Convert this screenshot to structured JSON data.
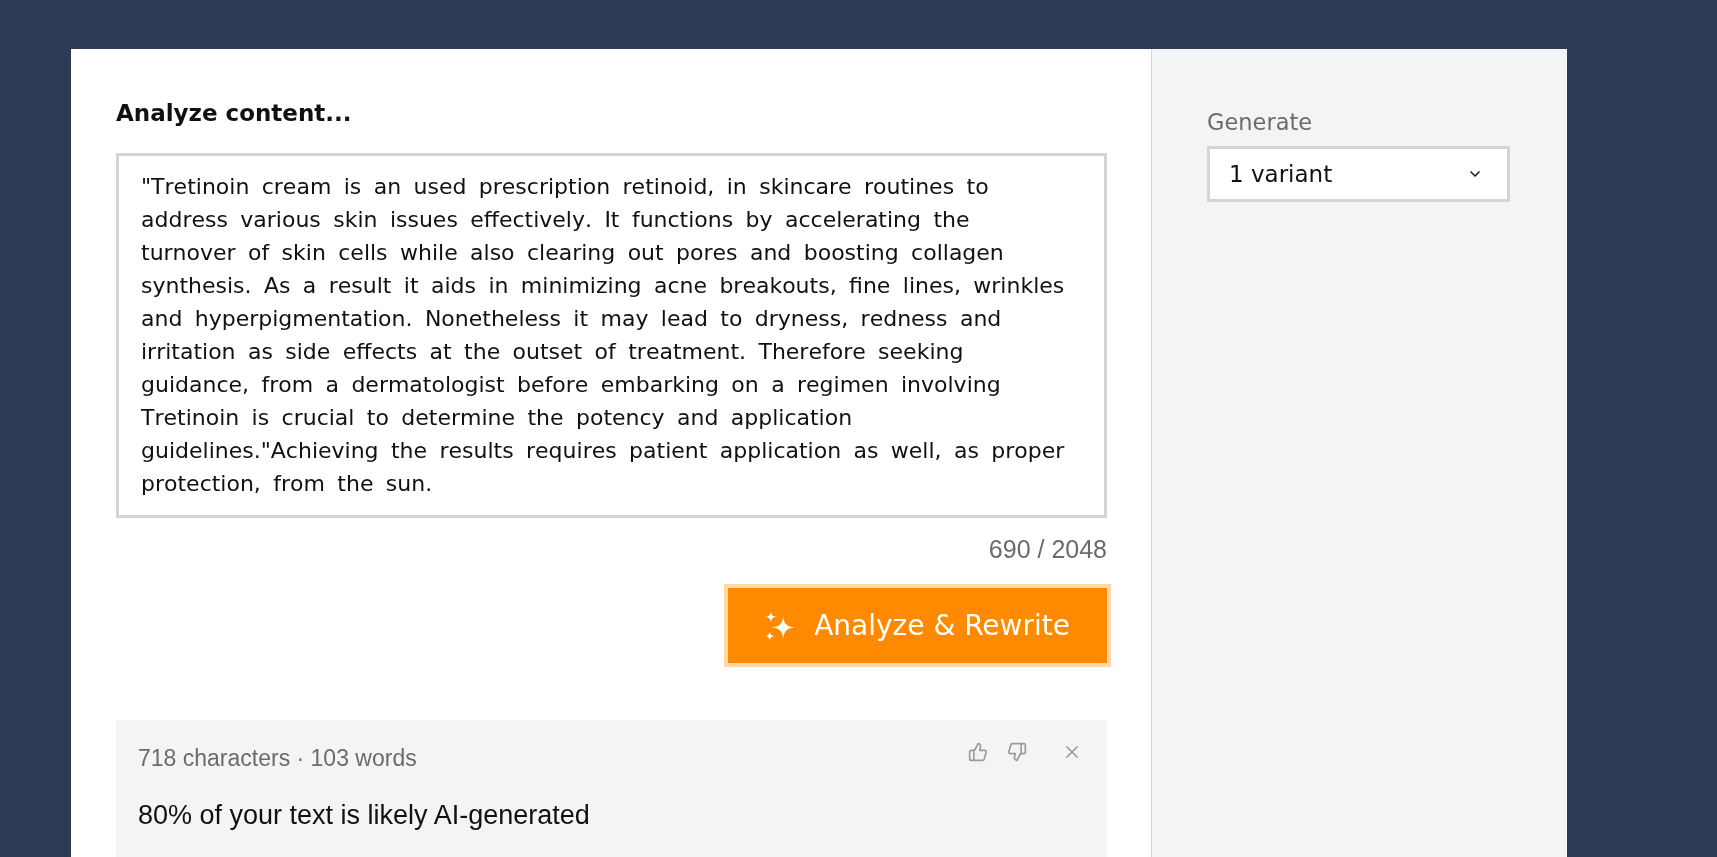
{
  "editor": {
    "heading": "Analyze content...",
    "text": "\"Tretinoin cream is an used prescription retinoid, in skincare routines to address various skin issues effectively. It functions by accelerating the turnover of skin cells while also clearing out pores and boosting collagen synthesis. As a result it aids in minimizing acne breakouts, fine lines, wrinkles and hyperpigmentation. Nonetheless it may lead to dryness, redness and irritation as side effects at the outset of treatment. Therefore seeking guidance, from a dermatologist before embarking on a regimen involving Tretinoin is crucial to determine the potency and application guidelines.\"Achieving the results requires patient application as well, as proper protection, from the sun.",
    "counter": "690 / 2048"
  },
  "analyze_button": {
    "label": "Analyze & Rewrite",
    "focused": true
  },
  "result": {
    "stats": "718 characters · 103 words",
    "verdict": "80% of your text is likely AI-generated"
  },
  "settings": {
    "label": "Generate",
    "select": {
      "value": "1 variant"
    }
  }
}
